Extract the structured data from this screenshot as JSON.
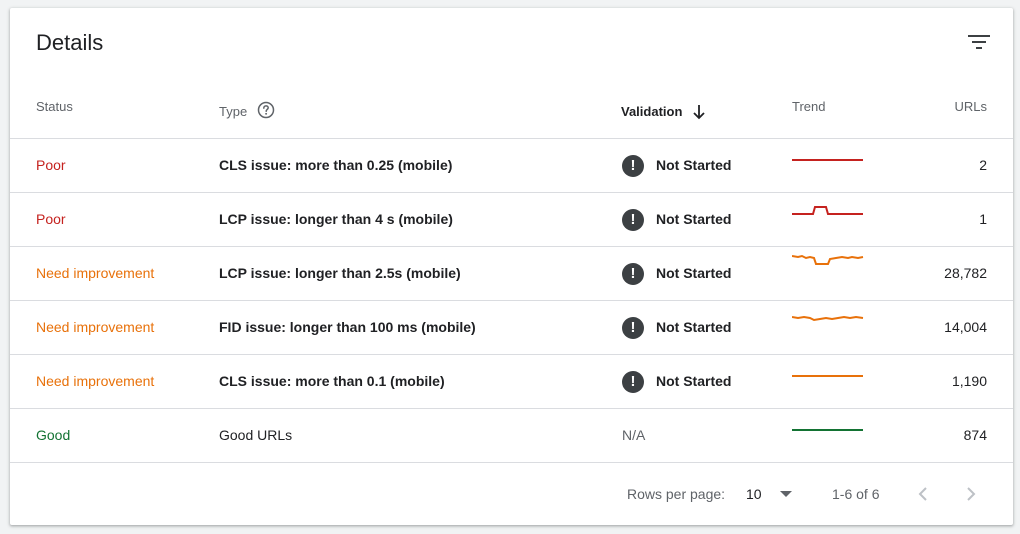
{
  "card": {
    "title": "Details"
  },
  "colors": {
    "poor": "#c5221f",
    "need": "#e8710a",
    "good": "#137333"
  },
  "header": {
    "status": "Status",
    "type": "Type",
    "validation": "Validation",
    "trend": "Trend",
    "urls": "URLs"
  },
  "rows": [
    {
      "status": "Poor",
      "status_kind": "poor",
      "type": "CLS issue: more than 0.25 (mobile)",
      "validation": "Not Started",
      "trend_icon": "flat-line",
      "urls": "2"
    },
    {
      "status": "Poor",
      "status_kind": "poor",
      "type": "LCP issue: longer than 4 s (mobile)",
      "validation": "Not Started",
      "trend_icon": "bump-line",
      "urls": "1"
    },
    {
      "status": "Need improvement",
      "status_kind": "need",
      "type": "LCP issue: longer than 2.5s (mobile)",
      "validation": "Not Started",
      "trend_icon": "dip-line",
      "urls": "28,782"
    },
    {
      "status": "Need improvement",
      "status_kind": "need",
      "type": "FID issue: longer than 100 ms (mobile)",
      "validation": "Not Started",
      "trend_icon": "wavy-line",
      "urls": "14,004"
    },
    {
      "status": "Need improvement",
      "status_kind": "need",
      "type": "CLS issue: more than 0.1 (mobile)",
      "validation": "Not Started",
      "trend_icon": "flat-line",
      "urls": "1,190"
    },
    {
      "status": "Good",
      "status_kind": "good",
      "type": "Good URLs",
      "validation": "N/A",
      "trend_icon": "flat-line",
      "urls": "874"
    }
  ],
  "footer": {
    "rows_per_page_label": "Rows per page:",
    "rows_per_page_value": "10",
    "range": "1-6 of 6"
  }
}
